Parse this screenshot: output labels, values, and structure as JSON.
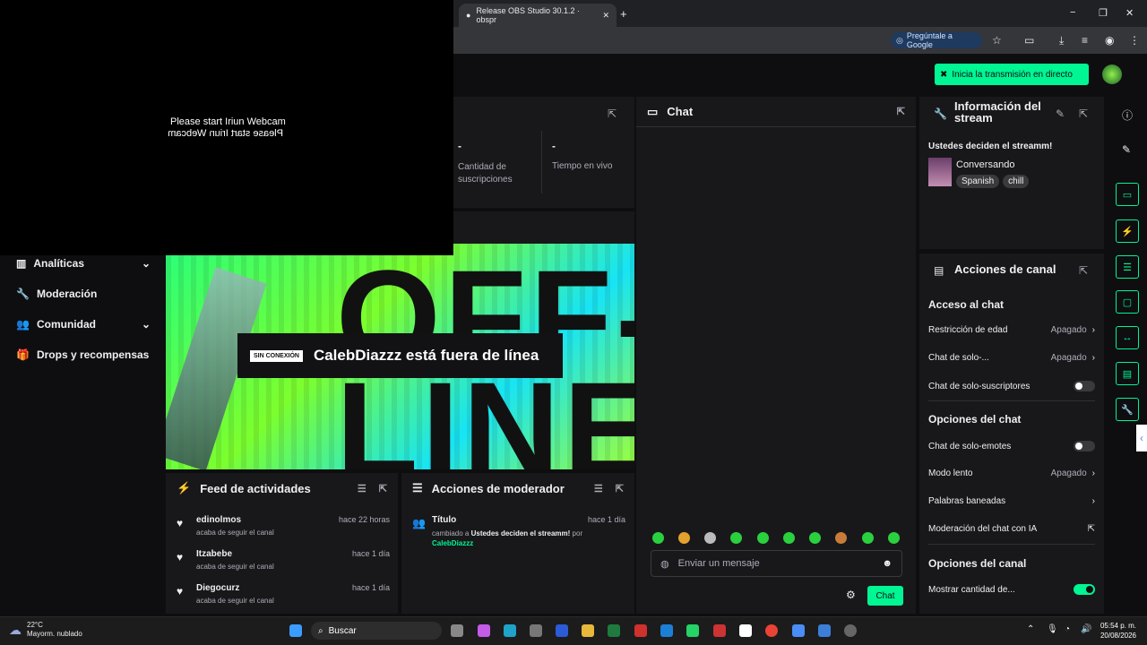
{
  "browser": {
    "tab_title": "Release OBS Studio 30.1.2 · obspr",
    "new_tab": "+",
    "ask_google": "Pregúntale a Google",
    "win_min": "−",
    "win_max": "❐",
    "win_close": "✕"
  },
  "twitch": {
    "go_live": "Inicia la transmisión en directo"
  },
  "webcam": {
    "line1": "Please start Iriun Webcam",
    "line2": "Please start Iriun Webcam"
  },
  "sidebar": {
    "items": [
      {
        "label": "Analíticas",
        "icon": "▥",
        "chevron": "⌄"
      },
      {
        "label": "Moderación",
        "icon": "🔧"
      },
      {
        "label": "Comunidad",
        "icon": "👥",
        "chevron": "⌄"
      },
      {
        "label": "Drops y recompensas",
        "icon": "🎁"
      }
    ]
  },
  "stats": {
    "cells": [
      {
        "value": "-",
        "label": "Cantidad de suscripciones"
      },
      {
        "value": "-",
        "label": "Tiempo en vivo"
      }
    ]
  },
  "offline": {
    "big_text": "OFF-LINE",
    "badge": "SIN CONEXIÓN",
    "message": "CalebDiazzz está fuera de línea"
  },
  "feed": {
    "title": "Feed de actividades",
    "rows": [
      {
        "name": "edinolmos",
        "time": "hace 22 horas",
        "sub": "acaba de seguir el canal"
      },
      {
        "name": "Itzabebe",
        "time": "hace 1 día",
        "sub": "acaba de seguir el canal"
      },
      {
        "name": "Diegocurz",
        "time": "hace 1 día",
        "sub": "acaba de seguir el canal"
      }
    ]
  },
  "mod": {
    "title": "Acciones de moderador",
    "row": {
      "name": "Título",
      "time": "hace 1 día",
      "sub1": "cambiado a",
      "sub2": "Ustedes deciden el streamm!",
      "sub3": "por",
      "user": "CalebDiazzz"
    }
  },
  "chat": {
    "title": "Chat",
    "placeholder": "Enviar un mensaje",
    "send": "Chat"
  },
  "info": {
    "title": "Información del stream",
    "stream_title": "Ustedes deciden el streamm!",
    "category": "Conversando",
    "tags": [
      "Spanish",
      "chill"
    ]
  },
  "actions": {
    "title": "Acciones de canal",
    "sections": {
      "access": "Acceso al chat",
      "chat_options": "Opciones del chat",
      "channel_options": "Opciones del canal"
    },
    "rows": {
      "age": {
        "label": "Restricción de edad",
        "value": "Apagado"
      },
      "followers": {
        "label": "Chat de solo-...",
        "value": "Apagado"
      },
      "subs": {
        "label": "Chat de solo-suscriptores"
      },
      "emotes": {
        "label": "Chat de solo-emotes"
      },
      "slow": {
        "label": "Modo lento",
        "value": "Apagado"
      },
      "banned": {
        "label": "Palabras baneadas"
      },
      "ai": {
        "label": "Moderación del chat con IA"
      },
      "show_count": {
        "label": "Mostrar cantidad de..."
      }
    }
  },
  "taskbar": {
    "temp": "22°C",
    "weather": "Mayorm. nublado",
    "search": "Buscar",
    "time": "05:54 p. m.",
    "date": "20/08/2026"
  },
  "colors": {
    "accent": "#00f593",
    "panel": "#18181b",
    "bg": "#0e0e10"
  }
}
